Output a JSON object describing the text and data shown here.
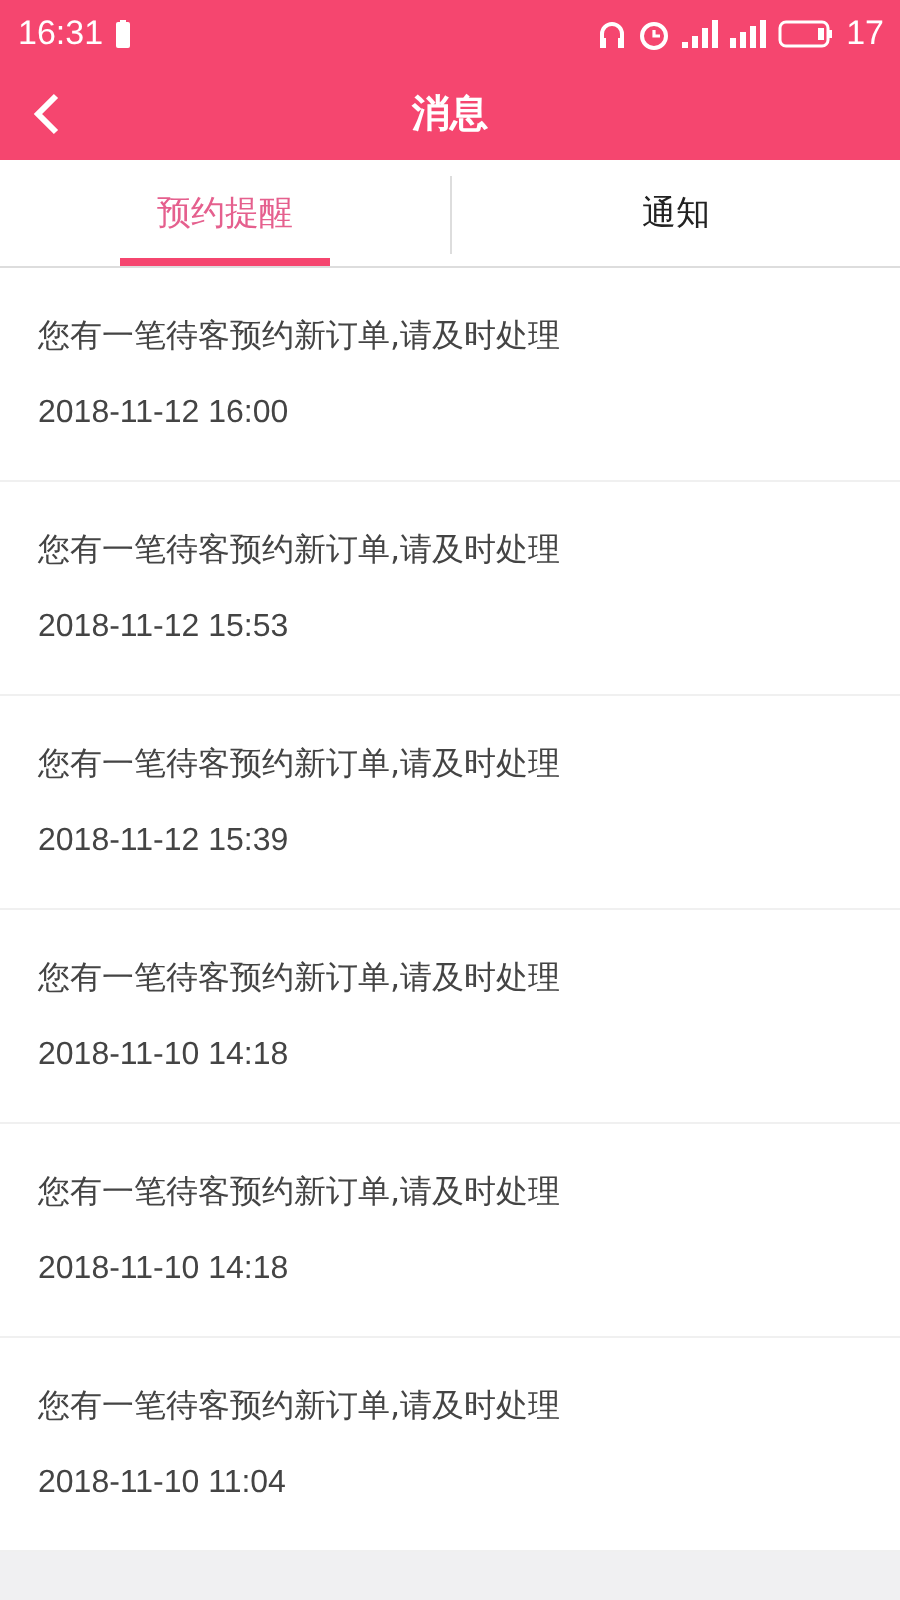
{
  "status_bar": {
    "time": "16:31",
    "battery_text": "17"
  },
  "header": {
    "title": "消息"
  },
  "tabs": [
    {
      "label": "预约提醒",
      "selected": true
    },
    {
      "label": "通知",
      "selected": false
    }
  ],
  "messages": [
    {
      "text": "您有一笔待客预约新订单,请及时处理",
      "time": "2018-11-12 16:00"
    },
    {
      "text": "您有一笔待客预约新订单,请及时处理",
      "time": "2018-11-12 15:53"
    },
    {
      "text": "您有一笔待客预约新订单,请及时处理",
      "time": "2018-11-12 15:39"
    },
    {
      "text": "您有一笔待客预约新订单,请及时处理",
      "time": "2018-11-10 14:18"
    },
    {
      "text": "您有一笔待客预约新订单,请及时处理",
      "time": "2018-11-10 14:18"
    },
    {
      "text": "您有一笔待客预约新订单,请及时处理",
      "time": "2018-11-10 11:04"
    }
  ]
}
